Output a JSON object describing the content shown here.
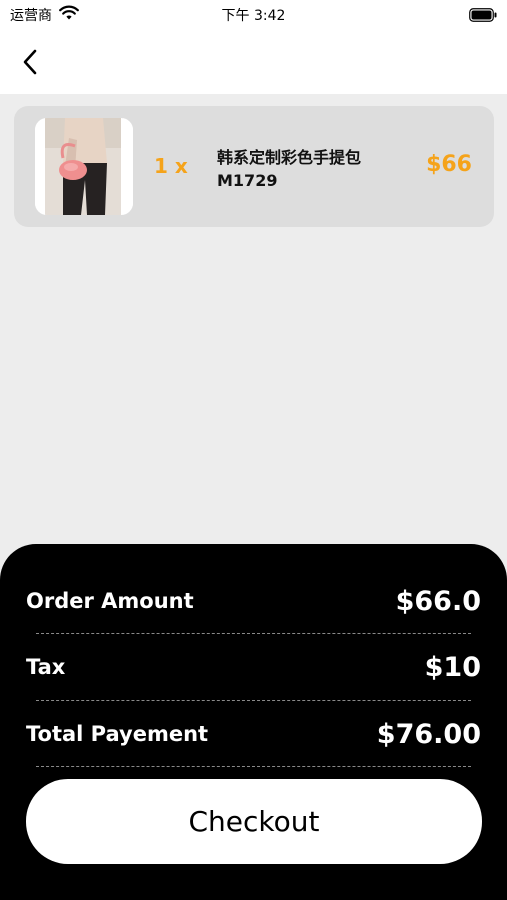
{
  "status_bar": {
    "carrier": "运营商",
    "time": "下午 3:42",
    "wifi_icon": "wifi-icon",
    "battery_icon": "battery-icon"
  },
  "nav_bar": {
    "back_icon": "chevron-left-icon"
  },
  "cart": {
    "items": [
      {
        "quantity": "1 x",
        "name": "韩系定制彩色手提包",
        "code": "M1729",
        "price": "$66",
        "image_icon": "product-photo"
      }
    ]
  },
  "summary": {
    "order_amount_label": "Order Amount",
    "order_amount_value": "$66.0",
    "tax_label": "Tax",
    "tax_value": "$10",
    "total_label": "Total Payement",
    "total_value": "$76.00",
    "checkout_label": "Checkout"
  },
  "colors": {
    "accent": "#f5a31a",
    "background": "#ededed",
    "card": "#dddddd",
    "panel": "#000000"
  }
}
